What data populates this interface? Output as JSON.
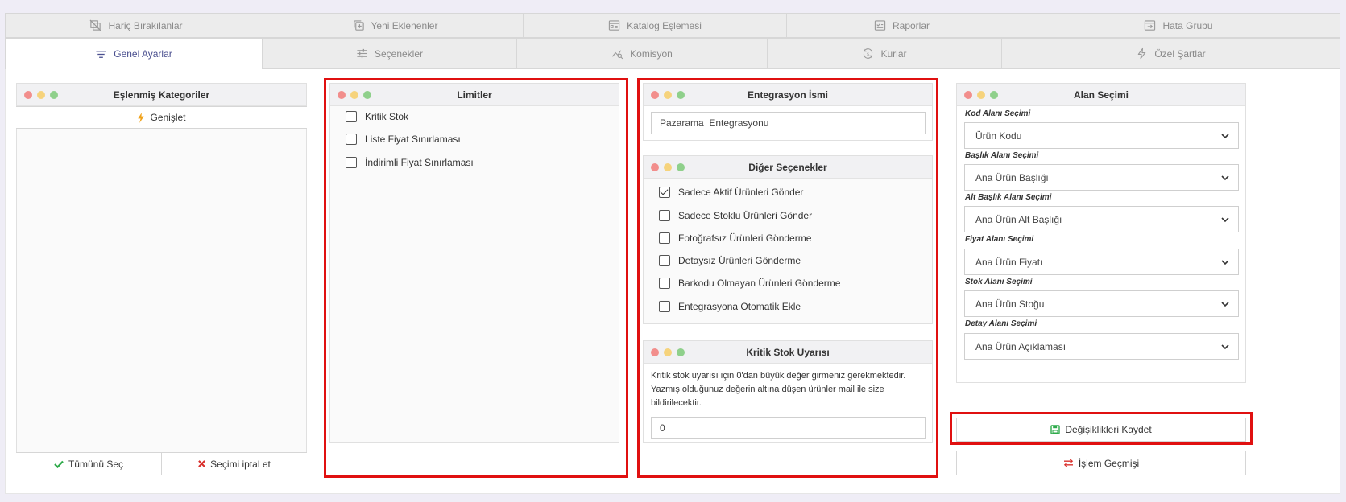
{
  "tabs_row1": [
    {
      "label": "Hariç Bırakılanlar",
      "icon": "excluded-icon"
    },
    {
      "label": "Yeni Eklenenler",
      "icon": "new-items-icon"
    },
    {
      "label": "Katalog Eşlemesi",
      "icon": "catalog-icon"
    },
    {
      "label": "Raporlar",
      "icon": "reports-icon"
    },
    {
      "label": "Hata Grubu",
      "icon": "error-group-icon"
    }
  ],
  "tabs_row2": [
    {
      "label": "Genel Ayarlar",
      "icon": "filter-lines-icon",
      "active": true
    },
    {
      "label": "Seçenekler",
      "icon": "sliders-icon"
    },
    {
      "label": "Komisyon",
      "icon": "chart-search-icon"
    },
    {
      "label": "Kurlar",
      "icon": "refresh-currency-icon"
    },
    {
      "label": "Özel Şartlar",
      "icon": "bolt-icon"
    }
  ],
  "categories_panel": {
    "title": "Eşlenmiş Kategoriler",
    "expand_label": "Genişlet",
    "select_all_label": "Tümünü Seç",
    "deselect_label": "Seçimi iptal et"
  },
  "limits_panel": {
    "title": "Limitler",
    "options": [
      {
        "label": "Kritik Stok",
        "checked": false
      },
      {
        "label": "Liste Fiyat Sınırlaması",
        "checked": false
      },
      {
        "label": "İndirimli Fiyat Sınırlaması",
        "checked": false
      }
    ]
  },
  "integration_panel": {
    "title": "Entegrasyon İsmi",
    "name_value": "Pazarama  Entegrasyonu"
  },
  "other_options_panel": {
    "title": "Diğer Seçenekler",
    "options": [
      {
        "label": "Sadece Aktif Ürünleri Gönder",
        "checked": true
      },
      {
        "label": "Sadece Stoklu Ürünleri Gönder",
        "checked": false
      },
      {
        "label": "Fotoğrafsız Ürünleri Gönderme",
        "checked": false
      },
      {
        "label": "Detaysız Ürünleri Gönderme",
        "checked": false
      },
      {
        "label": "Barkodu Olmayan Ürünleri Gönderme",
        "checked": false
      },
      {
        "label": "Entegrasyona Otomatik Ekle",
        "checked": false
      }
    ]
  },
  "critical_stock_panel": {
    "title": "Kritik Stok Uyarısı",
    "note_line1": "Kritik stok uyarısı için 0'dan büyük değer girmeniz gerekmektedir.",
    "note_line2": "Yazmış olduğunuz değerin altına düşen ürünler mail ile size",
    "note_line3": "bildirilecektir.",
    "value": "0"
  },
  "field_panel": {
    "title": "Alan Seçimi",
    "fields": [
      {
        "label": "Kod Alanı Seçimi",
        "value": "Ürün Kodu"
      },
      {
        "label": "Başlık Alanı Seçimi",
        "value": "Ana Ürün Başlığı"
      },
      {
        "label": "Alt Başlık Alanı Seçimi",
        "value": "Ana Ürün Alt Başlığı"
      },
      {
        "label": "Fiyat Alanı Seçimi",
        "value": "Ana Ürün Fiyatı"
      },
      {
        "label": "Stok Alanı Seçimi",
        "value": "Ana Ürün Stoğu"
      },
      {
        "label": "Detay Alanı Seçimi",
        "value": "Ana Ürün Açıklaması"
      }
    ]
  },
  "actions": {
    "save_label": "Değişiklikleri Kaydet",
    "history_label": "İşlem Geçmişi"
  },
  "colors": {
    "accent": "#4a4f8f",
    "highlight_border": "#e01010",
    "select_all_icon": "#2eaa4a",
    "deselect_icon": "#d9302c",
    "expand_icon": "#f0a21b",
    "save_icon": "#2eaa4a",
    "history_icon": "#d9302c"
  }
}
